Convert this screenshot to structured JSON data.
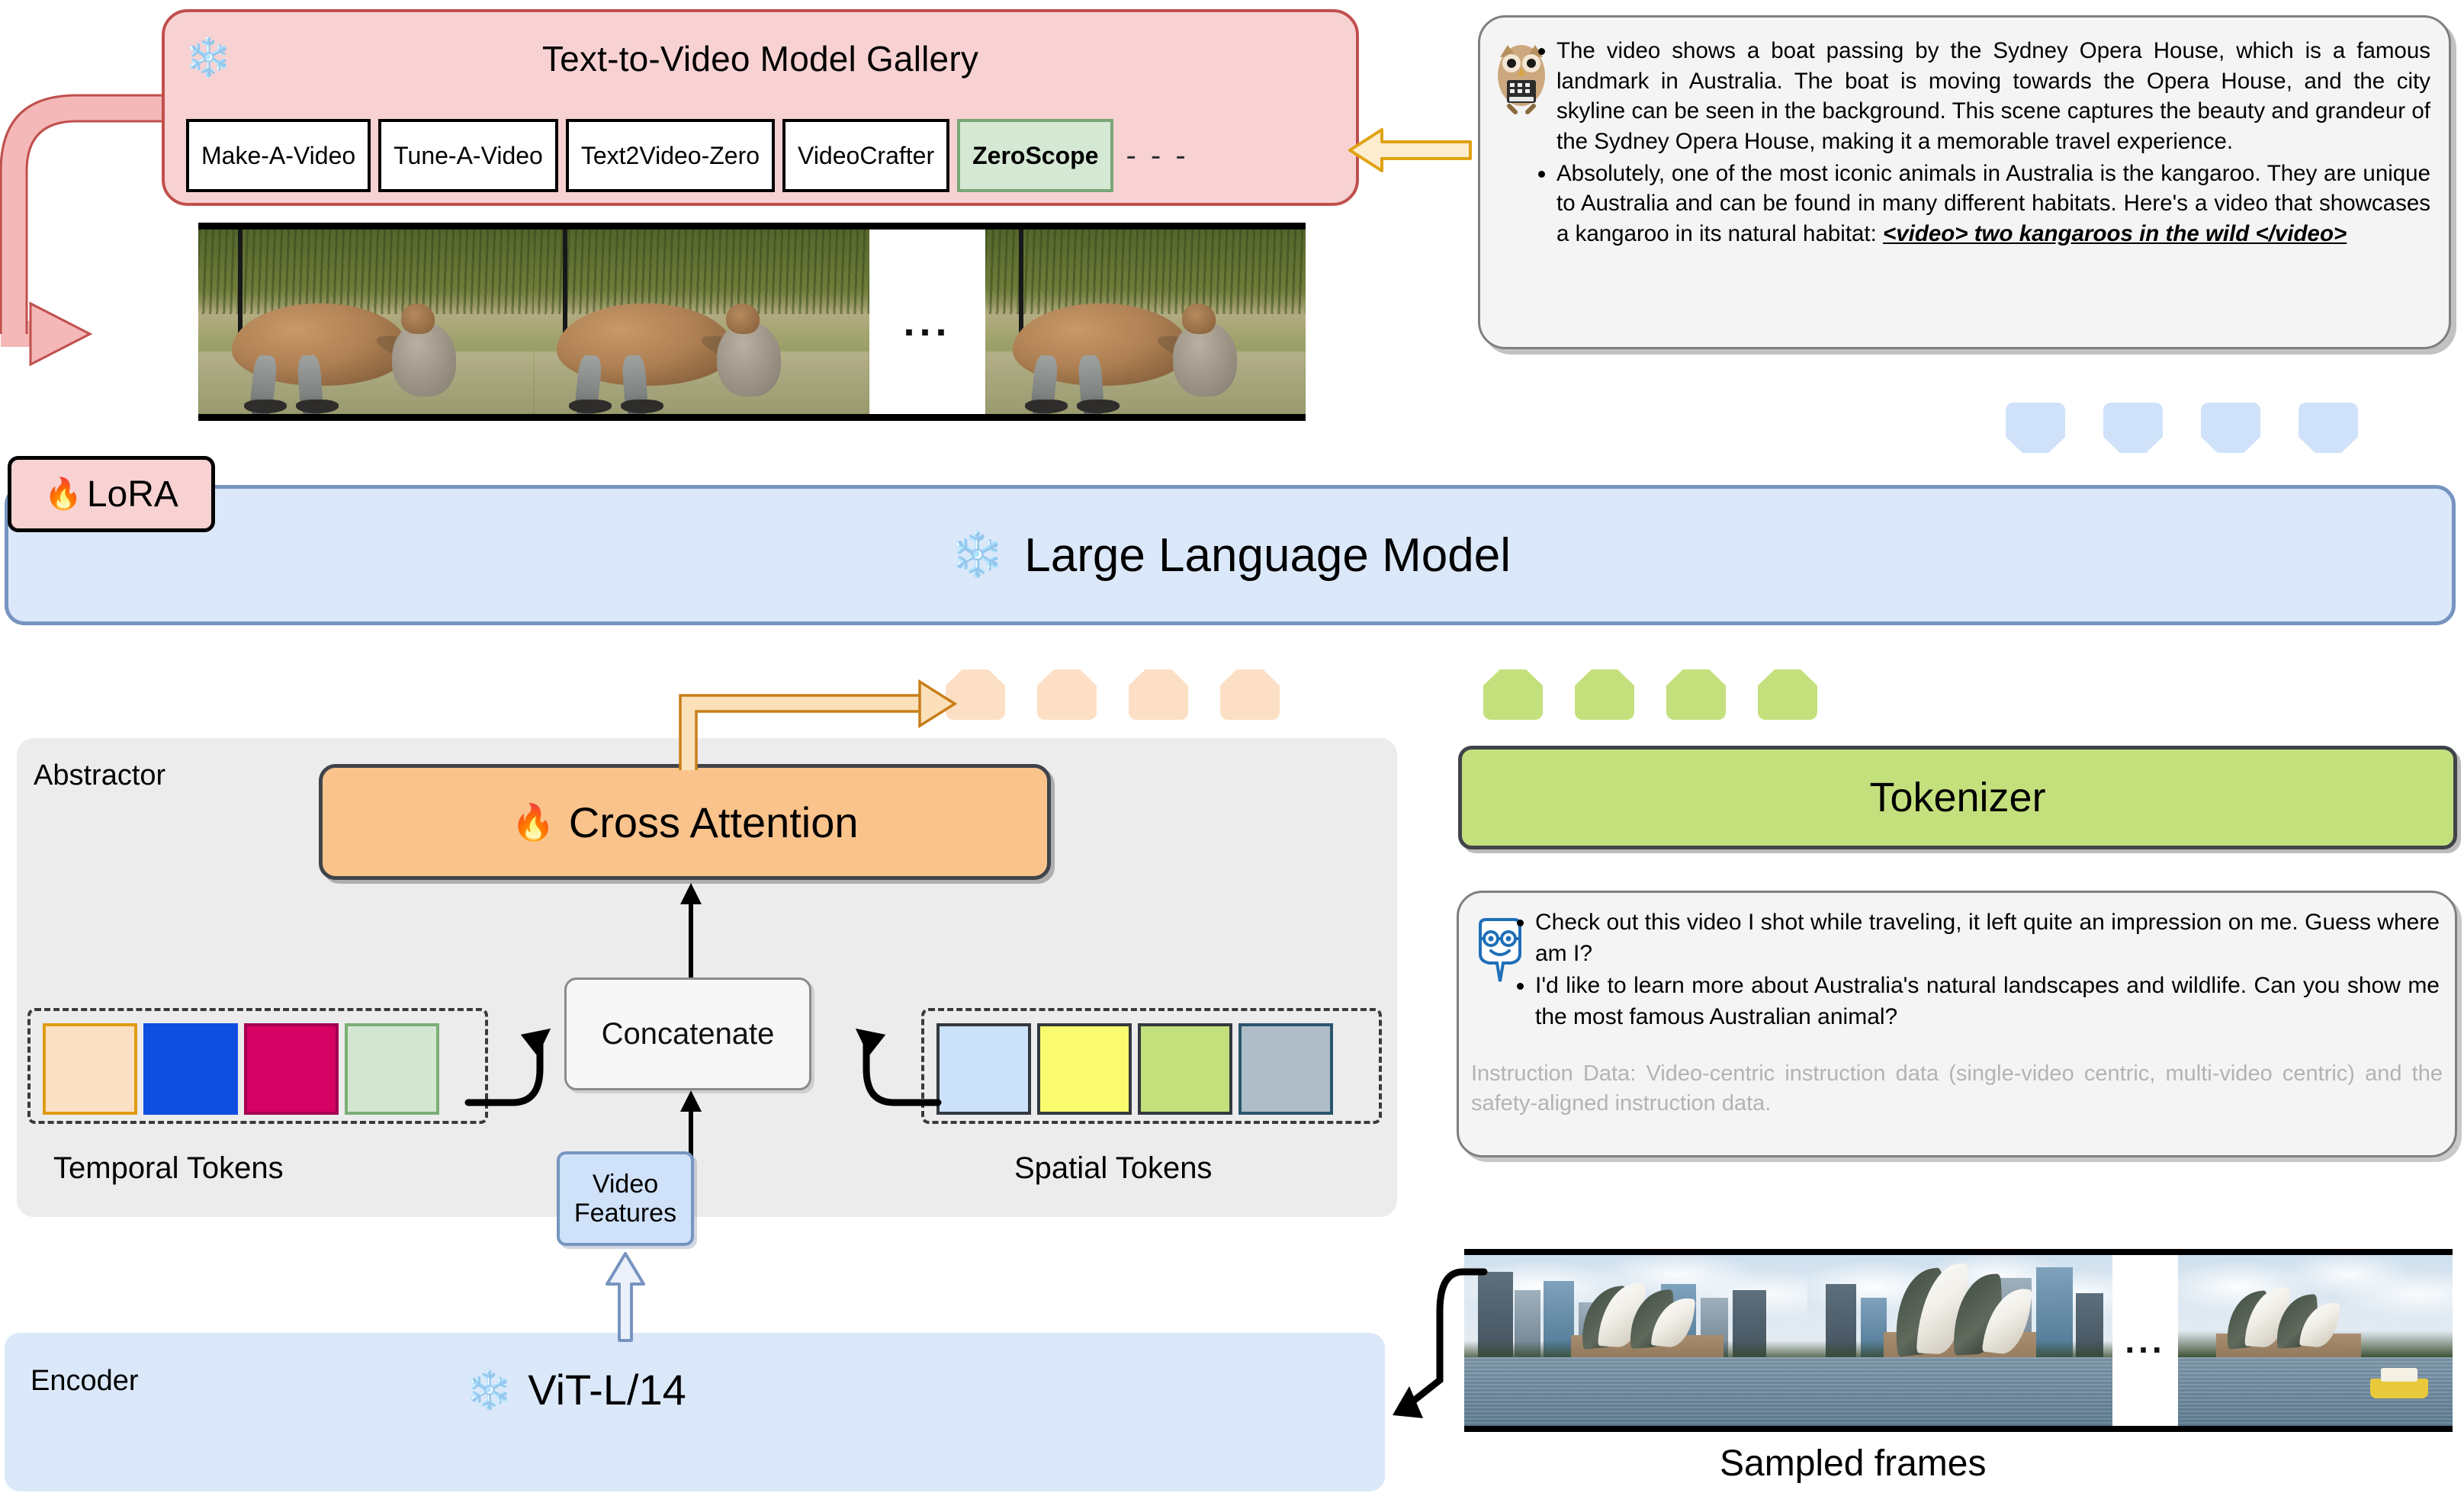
{
  "gallery": {
    "title": "Text-to-Video Model Gallery",
    "snow_icon": "snowflake-icon",
    "ellipsis": "- - -",
    "models": [
      {
        "label": "Make-A-Video",
        "selected": false
      },
      {
        "label": "Tune-A-Video",
        "selected": false
      },
      {
        "label": "Text2Video-Zero",
        "selected": false
      },
      {
        "label": "VideoCrafter",
        "selected": false
      },
      {
        "label": "ZeroScope",
        "selected": true
      }
    ],
    "selected_color": "#d5e8d4",
    "panel_color": "#f8d2d2",
    "panel_border": "#c0504d"
  },
  "kangaroo_strip": {
    "ellipsis": "...",
    "frame_labels": [
      "kangaroo-frame-1",
      "kangaroo-frame-2",
      "kangaroo-frame-3"
    ]
  },
  "assistant_bubble": {
    "icon": "owl-icon",
    "bullets": [
      "The video shows a boat passing by the Sydney Opera House, which is a famous landmark in Australia. The boat is moving towards the Opera House, and the city skyline can be seen in the background. This scene captures the beauty and grandeur of the Sydney Opera House, making it a memorable travel experience.",
      "Absolutely, one of the most iconic animals in Australia is the kangaroo. They are unique to Australia and can be found in many different habitats. Here's a video that showcases a kangaroo in its natural habitat: "
    ],
    "video_tag": "<video>  two kangaroos in the wild </video>"
  },
  "lora": {
    "label": "LoRA",
    "fire_icon": "fire-icon",
    "color": "#f8d2d2"
  },
  "llm": {
    "label": "Large Language Model",
    "snow_icon": "snowflake-icon",
    "color": "#dbe8fa",
    "border": "#7794c0"
  },
  "abstractor": {
    "label": "Abstractor",
    "cross_attention": {
      "label": "Cross Attention",
      "fire_icon": "fire-icon",
      "color": "#fac38c"
    },
    "concatenate": {
      "label": "Concatenate"
    },
    "temporal_tokens": {
      "label": "Temporal Tokens",
      "colors": [
        "#fce0c4",
        "#0f4fe0",
        "#d60264",
        "#d3e6d1"
      ],
      "borders": [
        "#e09c10",
        "#0f4fe0",
        "#a50150",
        "#7cae77"
      ]
    },
    "spatial_tokens": {
      "label": "Spatial Tokens",
      "colors": [
        "#cbe2fa",
        "#fafa6e",
        "#c4e07d",
        "#aebdc8"
      ],
      "borders": [
        "#33393f",
        "#33393f",
        "#33393f",
        "#2b556e"
      ]
    },
    "video_features": {
      "line1": "Video",
      "line2": "Features",
      "color": "#cfe2f9"
    }
  },
  "encoder": {
    "label": "Encoder",
    "model": "ViT-L/14",
    "snow_icon": "snowflake-icon",
    "color": "#dbe8fa"
  },
  "tokenizer": {
    "label": "Tokenizer",
    "color": "#c4e07d"
  },
  "user_bubble": {
    "icon": "user-avatar-icon",
    "bullets": [
      "Check out this video I shot while traveling, it left quite an impression on me. Guess where am I?",
      "I'd like to learn more about Australia's natural landscapes and wildlife. Can you show me the most famous Australian animal?"
    ],
    "instruction_data": "Instruction Data: Video-centric instruction data (single-video centric, multi-video centric) and the safety-aligned instruction data."
  },
  "sampled_frames": {
    "caption": "Sampled frames",
    "ellipsis": "...",
    "frame_labels": [
      "opera-house-frame-1",
      "opera-house-frame-2",
      "opera-house-frame-3"
    ]
  },
  "tokens": {
    "blue_count": 4,
    "peach_count": 4,
    "green_count": 4,
    "blue_color": "#cfe2f9",
    "peach_color": "#fcdfc4",
    "green_color": "#c4e07d"
  },
  "arrows": {
    "gold_arrow": "gallery-feedback-arrow",
    "red_arrow": "video-regeneration-arrow",
    "orange_arrow": "cross-attention-output-arrow",
    "frames_arrow": "frames-to-encoder-arrow"
  }
}
